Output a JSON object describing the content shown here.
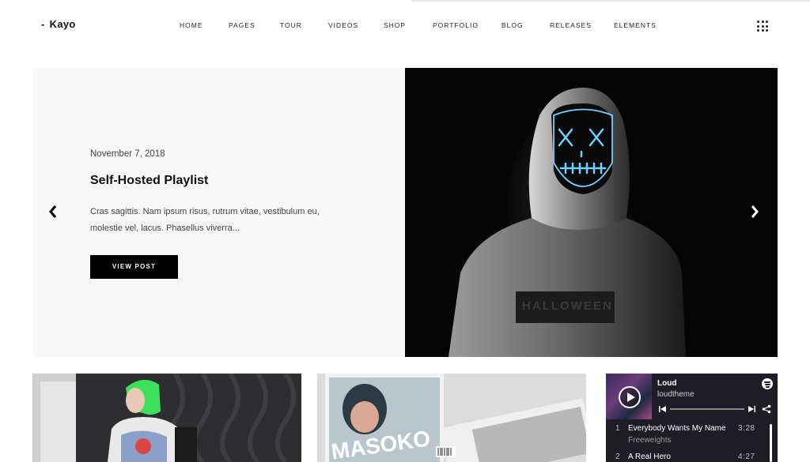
{
  "header": {
    "logo_dash": "-",
    "logo": "Kayo",
    "nav": [
      "HOME",
      "PAGES",
      "TOUR",
      "VIDEOS",
      "SHOP",
      "PORTFOLIO",
      "BLOG",
      "RELEASES",
      "ELEMENTS"
    ]
  },
  "hero": {
    "date": "November 7, 2018",
    "title": "Self-Hosted Playlist",
    "excerpt": "Cras sagittis. Nam ipsum risus, rutrum vitae, vestibulum eu, molestie vel, lacus. Phasellus viverra...",
    "button": "VIEW POST",
    "image_text": "HALLOWEEN"
  },
  "cards": {
    "album_text": "MASOKO"
  },
  "player": {
    "title": "Loud",
    "artist": "loudtheme",
    "tracks": [
      {
        "num": "1",
        "name": "Everybody Wants My Name",
        "artist": "Freeweights",
        "time": "3:28"
      },
      {
        "num": "2",
        "name": "A Real Hero",
        "artist": "",
        "time": "4:27"
      }
    ]
  },
  "icons": {
    "menu": "grid-menu-icon",
    "prev": "chevron-left-icon",
    "next": "chevron-right-icon",
    "spotify": "spotify-icon",
    "share": "share-icon"
  },
  "colors": {
    "hero_left_bg": "#f7f7f7",
    "button_bg": "#000000",
    "mask_neon": "#6fd0ff",
    "hair_green": "#3de05a",
    "player_bg": "#1e1c24"
  }
}
